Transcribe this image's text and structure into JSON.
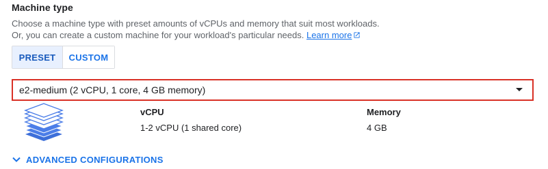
{
  "section": {
    "title": "Machine type",
    "description_line1": "Choose a machine type with preset amounts of vCPUs and memory that suit most workloads.",
    "description_line2_prefix": "Or, you can create a custom machine for your workload's particular needs. ",
    "learn_more": "Learn more"
  },
  "toggle": {
    "preset_label": "PRESET",
    "custom_label": "CUSTOM",
    "selected": "PRESET"
  },
  "machine_select": {
    "value": "e2-medium (2 vCPU, 1 core, 4 GB memory)"
  },
  "specs": {
    "vcpu_label": "vCPU",
    "vcpu_value": "1-2 vCPU (1 shared core)",
    "memory_label": "Memory",
    "memory_value": "4 GB"
  },
  "advanced": {
    "label": "ADVANCED CONFIGURATIONS"
  },
  "colors": {
    "accent": "#1a73e8",
    "error_border": "#d93025",
    "selected_bg": "#e8f0fe",
    "stack_fill": "#4c7ee8"
  },
  "icons": {
    "external_link": "open-in-new-icon",
    "dropdown": "caret-down-icon",
    "machine_stack": "layers-icon",
    "expand": "chevron-down-icon"
  }
}
